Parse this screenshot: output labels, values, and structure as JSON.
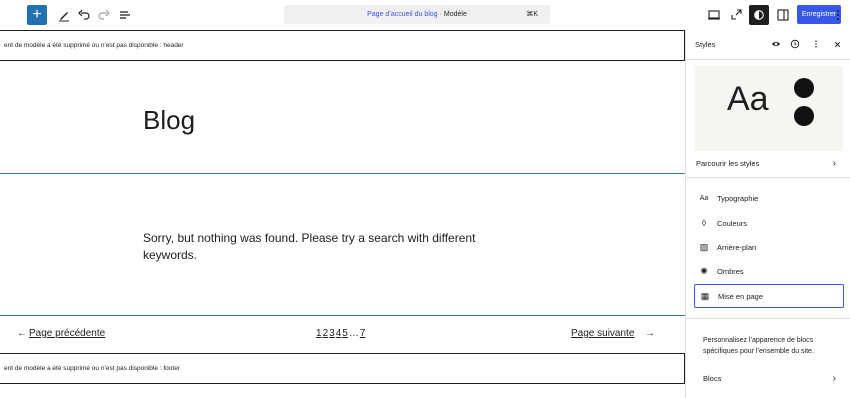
{
  "toolbar": {
    "add_label": "+",
    "doc_title": "Page d’accueil du blog",
    "doc_separator": "·",
    "doc_type": "Modèle",
    "doc_shortcut": "⌘K",
    "save_label": "Enregistrer",
    "accent": "#3858e9"
  },
  "canvas": {
    "header_notice": "ent de modèle a été supprimé ou n’est pas disponible : header",
    "blog_title": "Blog",
    "no_results": "Sorry, but nothing was found. Please try a search with different keywords.",
    "pagination": {
      "prev_arrow": "←",
      "prev_label": "Page précédente",
      "pages": [
        "1",
        "2",
        "3",
        "4",
        "5",
        "…",
        "7"
      ],
      "next_label": "Page suivante",
      "next_arrow": "→"
    },
    "footer_notice": "ent de modèle a été supprimé ou n’est pas disponible : footer"
  },
  "sidebar": {
    "title": "Styles",
    "preview_text": "Aa",
    "browse_label": "Parcourir les styles",
    "items": [
      {
        "label": "Typographie",
        "icon": "typography-icon",
        "glyph": "Aa"
      },
      {
        "label": "Couleurs",
        "icon": "droplet-icon",
        "glyph": "◊"
      },
      {
        "label": "Arrière-plan",
        "icon": "background-icon",
        "glyph": "▨"
      },
      {
        "label": "Ombres",
        "icon": "shadow-icon",
        "glyph": "✺"
      },
      {
        "label": "Mise en page",
        "icon": "layout-icon",
        "glyph": "▦"
      }
    ],
    "description": "Personnalisez l’apparence de blocs spécifiques pour l’ensemble du site.",
    "blocks_label": "Blocs"
  }
}
